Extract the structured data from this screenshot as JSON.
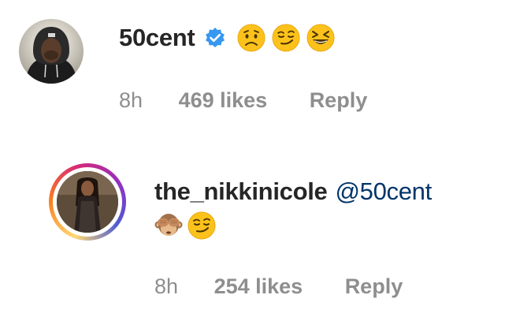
{
  "comments": [
    {
      "username": "50cent",
      "verified": true,
      "emojis": [
        "worried-face",
        "smirking-face",
        "grinning-squinting-face"
      ],
      "time": "8h",
      "likes": "469 likes",
      "reply": "Reply"
    },
    {
      "username": "the_nikkinicole",
      "mention": "@50cent",
      "emojis": [
        "see-no-evil-monkey",
        "smirking-face"
      ],
      "time": "8h",
      "likes": "254 likes",
      "reply": "Reply"
    }
  ],
  "colors": {
    "username": "#262626",
    "meta": "#8e8e8e",
    "mention": "#003569",
    "verified": "#3897f0"
  }
}
